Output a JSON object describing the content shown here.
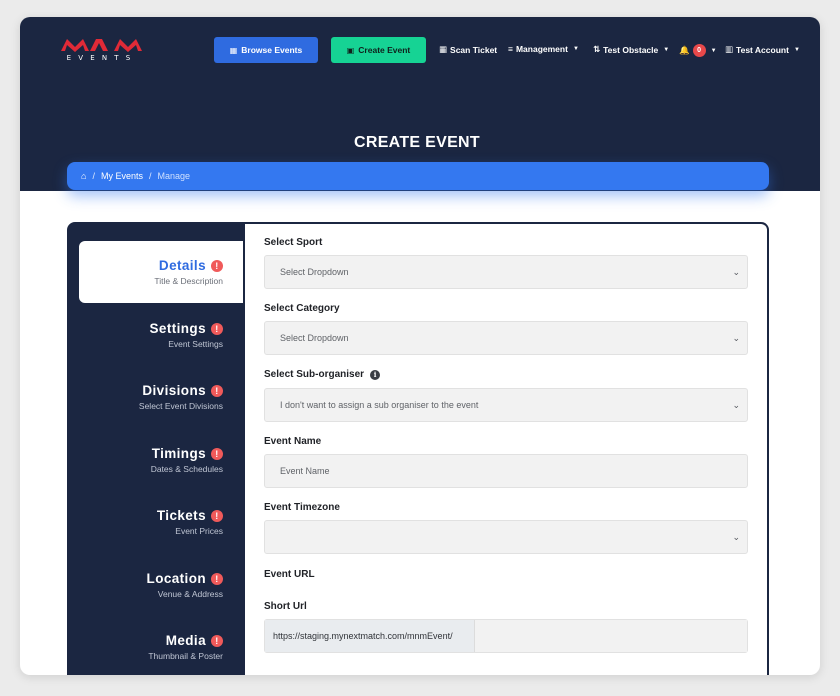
{
  "brand": {
    "logo_text": "MNM",
    "logo_sub": "EVENTS",
    "accent": "#e02a37"
  },
  "nav": {
    "browse_label": "Browse Events",
    "create_label": "Create Event",
    "scan_label": "Scan Ticket",
    "management_label": "Management",
    "obstacle_label": "Test Obstacle",
    "notification_count": "0",
    "account_label": "Test Account"
  },
  "page": {
    "title": "CREATE EVENT"
  },
  "breadcrumb": {
    "my_events": "My Events",
    "current": "Manage",
    "separator": "/"
  },
  "sidebar": {
    "items": [
      {
        "title": "Details",
        "subtitle": "Title & Description"
      },
      {
        "title": "Settings",
        "subtitle": "Event Settings"
      },
      {
        "title": "Divisions",
        "subtitle": "Select Event Divisions"
      },
      {
        "title": "Timings",
        "subtitle": "Dates & Schedules"
      },
      {
        "title": "Tickets",
        "subtitle": "Event Prices"
      },
      {
        "title": "Location",
        "subtitle": "Venue & Address"
      },
      {
        "title": "Media",
        "subtitle": "Thumbnail & Poster"
      }
    ],
    "alert_glyph": "!"
  },
  "form": {
    "sport": {
      "label": "Select Sport",
      "value": "Select Dropdown"
    },
    "category": {
      "label": "Select Category",
      "value": "Select Dropdown"
    },
    "sub_organiser": {
      "label": "Select Sub-organiser",
      "value": "I don't want to assign a sub organiser to the event"
    },
    "event_name": {
      "label": "Event Name",
      "placeholder": "Event Name"
    },
    "timezone": {
      "label": "Event Timezone",
      "value": ""
    },
    "event_url": {
      "label": "Event URL"
    },
    "short_url": {
      "label": "Short Url",
      "prefix": "https://staging.mynextmatch.com/mnmEvent/"
    }
  },
  "colors": {
    "navy": "#1b2641",
    "primary": "#2f6be0",
    "success": "#16d394",
    "breadcrumb": "#3478f0",
    "alert": "#f05a5a"
  }
}
